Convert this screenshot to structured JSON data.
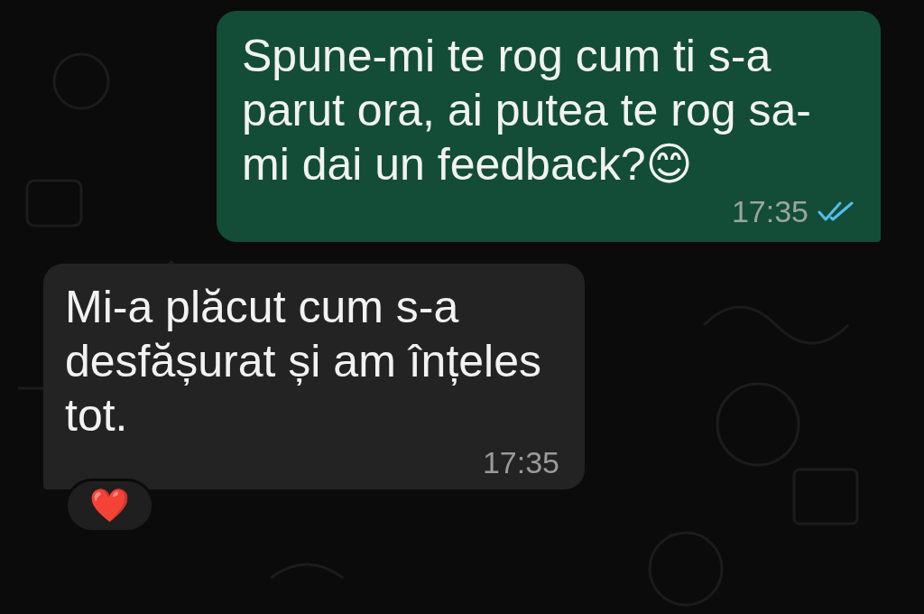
{
  "messages": [
    {
      "kind": "outgoing",
      "text": "Spune-mi te rog cum ti s-a parut ora, ai putea te rog sa-mi dai un feedback?😊",
      "time": "17:35",
      "read": true
    },
    {
      "kind": "incoming",
      "text": "Mi-a plăcut cum s-a desfășurat și am înțeles tot.",
      "time": "17:35",
      "reaction": "❤️"
    }
  ]
}
